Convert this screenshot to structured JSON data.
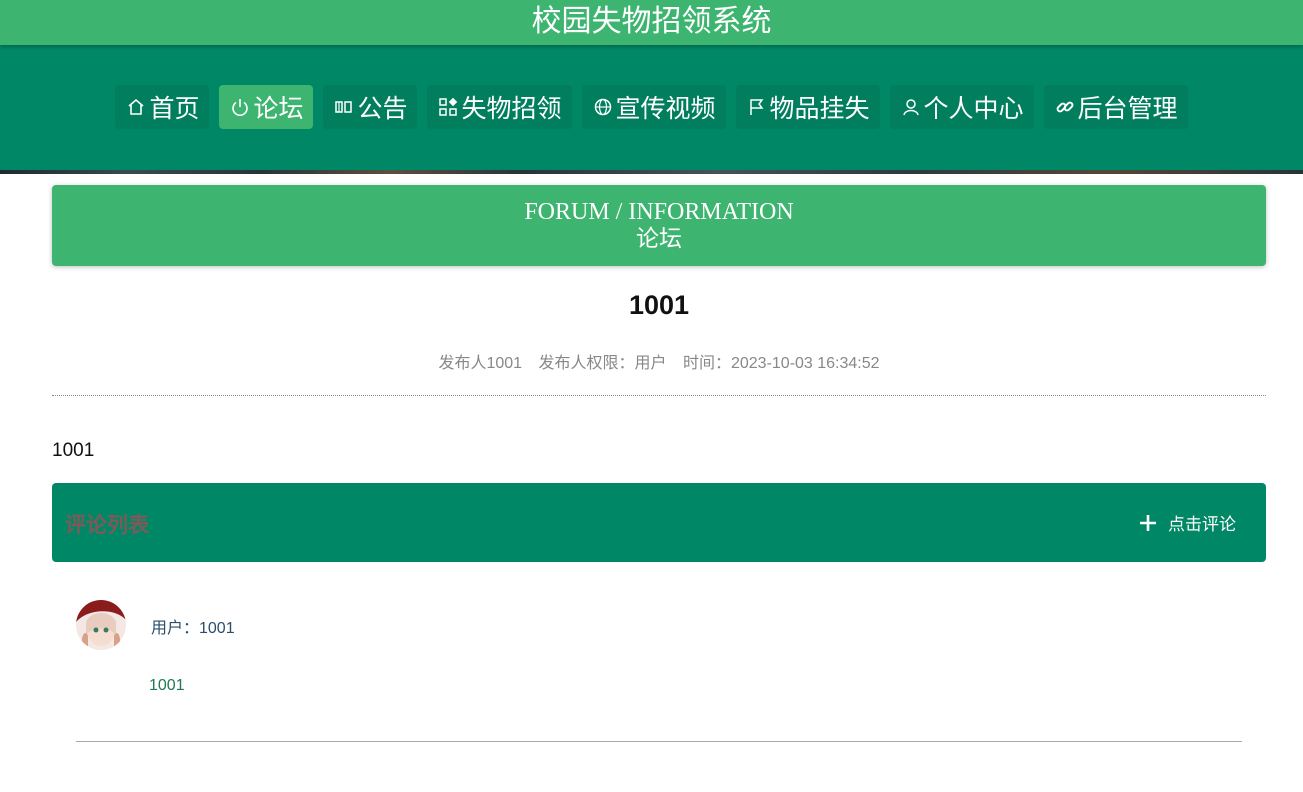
{
  "header": {
    "site_title": "校园失物招领系统"
  },
  "nav": {
    "items": [
      {
        "label": "首页",
        "icon": "home-icon"
      },
      {
        "label": "论坛",
        "icon": "power-icon",
        "active": true
      },
      {
        "label": "公告",
        "icon": "announcement-icon"
      },
      {
        "label": "失物招领",
        "icon": "grid-icon"
      },
      {
        "label": "宣传视频",
        "icon": "globe-icon"
      },
      {
        "label": "物品挂失",
        "icon": "flag-icon"
      },
      {
        "label": "个人中心",
        "icon": "user-icon"
      },
      {
        "label": "后台管理",
        "icon": "link-icon"
      }
    ]
  },
  "section": {
    "title_en": "FORUM / INFORMATION",
    "title_cn": "论坛"
  },
  "post": {
    "title": "1001",
    "author": "发布人1001",
    "role": "发布人权限：用户",
    "time": "时间：2023-10-03 16:34:52",
    "content": "1001"
  },
  "comments": {
    "title": "评论列表",
    "add_label": "点击评论",
    "items": [
      {
        "user": "用户：1001",
        "body": "1001"
      }
    ]
  },
  "colors": {
    "header_green": "#3db570",
    "nav_dark_green": "#008866",
    "comments_title": "#7d5a5a"
  }
}
